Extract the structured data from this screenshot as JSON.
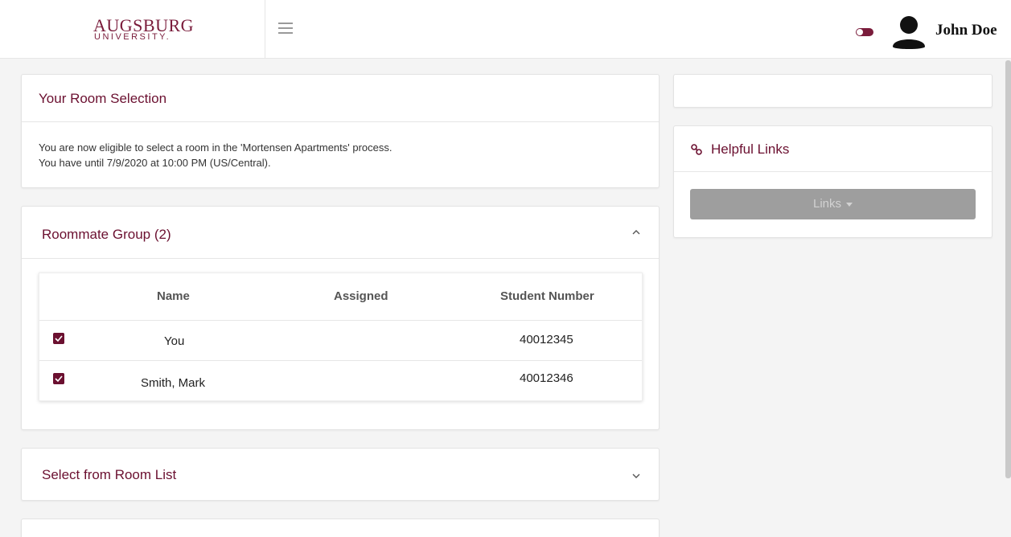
{
  "header": {
    "logo_main": "AUGSBURG",
    "logo_sub": "UNIVERSITY.",
    "user_name": "John Doe"
  },
  "room_selection": {
    "title": "Your Room Selection",
    "line1": "You are now eligible to select a room in the 'Mortensen Apartments' process.",
    "line2": "You have until 7/9/2020 at 10:00 PM (US/Central)."
  },
  "roommate_group": {
    "title": "Roommate Group (2)",
    "columns": [
      "Name",
      "Assigned",
      "Student Number"
    ],
    "rows": [
      {
        "name": "You",
        "assigned": "",
        "student_number": "40012345",
        "checked": true
      },
      {
        "name": "Smith, Mark",
        "assigned": "",
        "student_number": "40012346",
        "checked": true
      }
    ]
  },
  "room_list": {
    "title": "Select from Room List"
  },
  "helpful_links": {
    "title": "Helpful Links",
    "button_label": "Links"
  },
  "icons": {
    "hamburger": "menu-icon",
    "toggle": "toggle-icon",
    "avatar": "user-avatar-icon",
    "links": "link-icon",
    "collapse": "chevron-up-icon",
    "expand": "chevron-down-icon",
    "check": "checkbox-checked-icon"
  },
  "colors": {
    "brand": "#7a1c3b",
    "title": "#6b1030",
    "button_disabled": "#9e9e9e"
  }
}
